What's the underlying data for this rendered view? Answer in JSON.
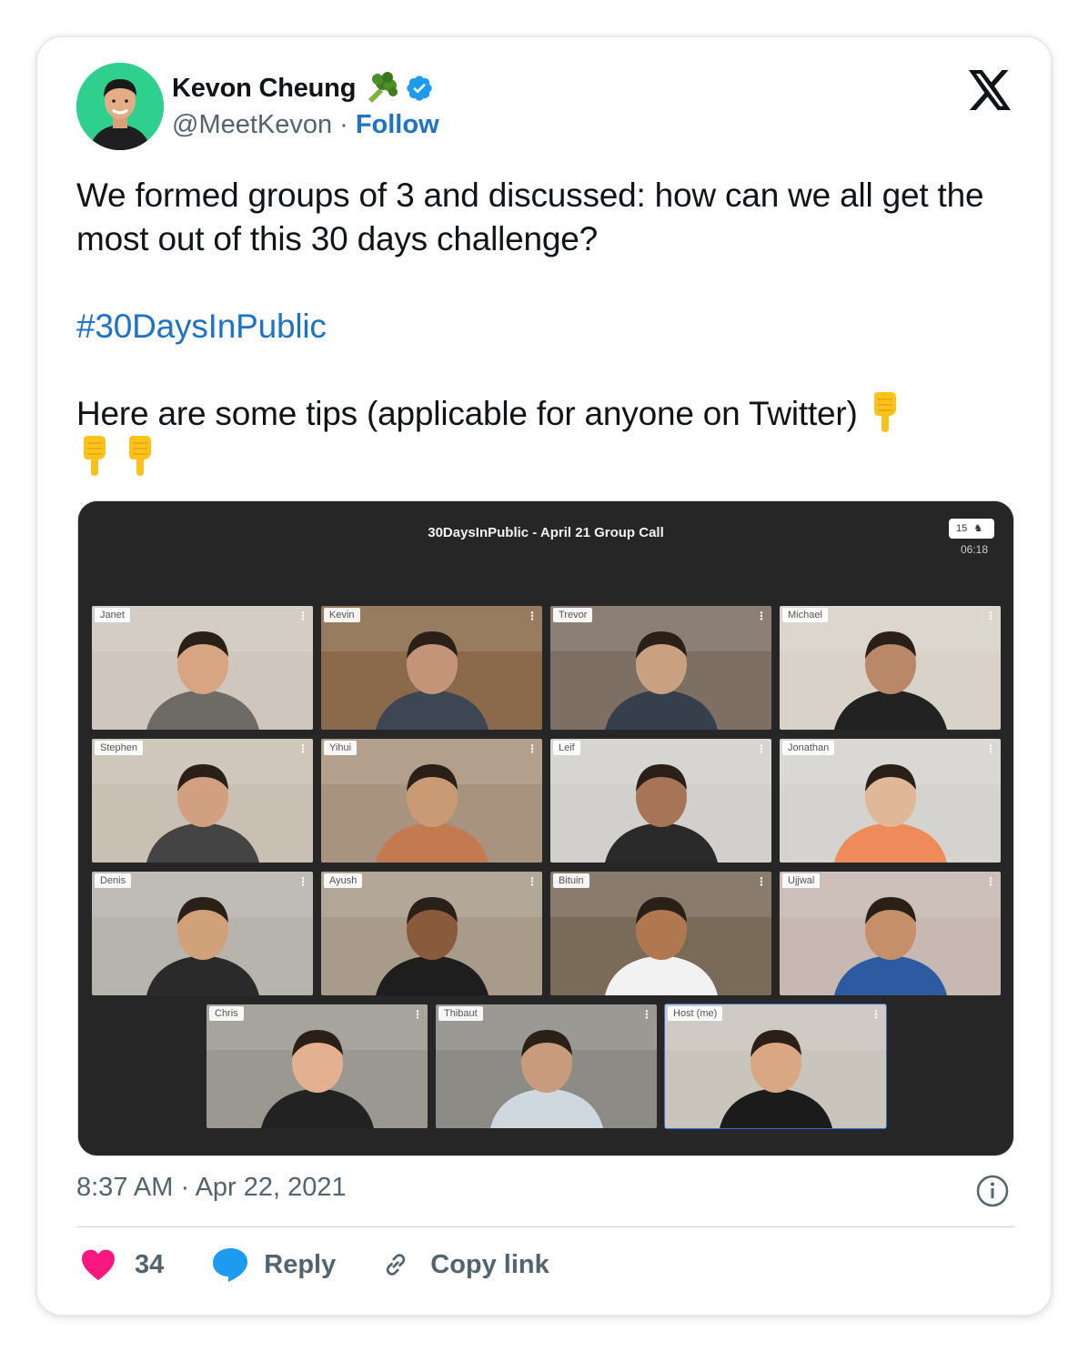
{
  "tweet": {
    "author_name": "Kevon Cheung",
    "handle": "@MeetKevon",
    "separator": "·",
    "follow_label": "Follow",
    "text_line1": "We formed groups of 3 and discussed: how can we all get the most out of this 30 days challenge?",
    "hashtag": "#30DaysInPublic",
    "text_line3": "Here are some tips (applicable for anyone on Twitter)",
    "timestamp": "8:37 AM · Apr 22, 2021",
    "like_count": "34",
    "reply_label": "Reply",
    "copy_link_label": "Copy link"
  },
  "media": {
    "call_title": "30DaysInPublic - April 21 Group Call",
    "participant_count": "15",
    "timer": "06:18",
    "participants": [
      "Janet",
      "Kevin",
      "Trevor",
      "Michael",
      "Stephen",
      "Yihui",
      "Leif",
      "Jonathan",
      "Denis",
      "Ayush",
      "Bituin",
      "Ujjwal",
      "Chris",
      "Thibaut",
      "Host (me)"
    ],
    "tile_menu": "⋮"
  },
  "colors": {
    "link": "#1d72c9",
    "text": "#0f1419",
    "secondary": "#536471",
    "like": "#f91880",
    "reply": "#1d9bf0",
    "verified": "#1d9bf0"
  },
  "icons": [
    "broccoli-icon",
    "verified-badge-icon",
    "x-logo-icon",
    "pointing-down-emoji",
    "info-icon",
    "heart-icon",
    "reply-bubble-icon",
    "link-icon"
  ]
}
